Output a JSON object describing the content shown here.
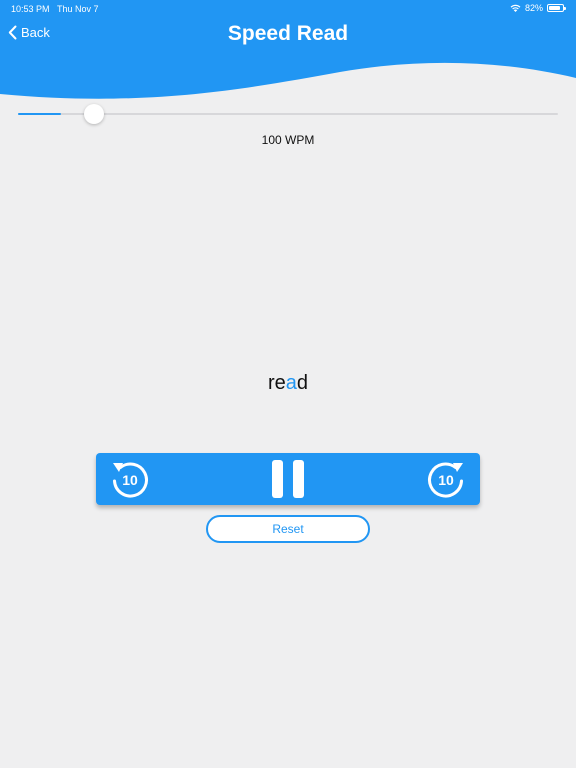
{
  "colors": {
    "accent": "#2196f3",
    "background": "#efeff0"
  },
  "status_bar": {
    "time": "10:53 PM",
    "date": "Thu Nov 7",
    "battery_text": "82%",
    "battery_level": 0.82
  },
  "header": {
    "back_label": "Back",
    "title": "Speed Read"
  },
  "speed": {
    "label": "100 WPM",
    "slider_fraction": 0.08
  },
  "reader": {
    "word_before": "re",
    "word_focus": "a",
    "word_after": "d"
  },
  "controls": {
    "rewind_icon": "rewind-10-icon",
    "rewind_label": "10",
    "pause_icon": "pause-icon",
    "forward_icon": "forward-10-icon",
    "forward_label": "10",
    "reset_label": "Reset"
  }
}
